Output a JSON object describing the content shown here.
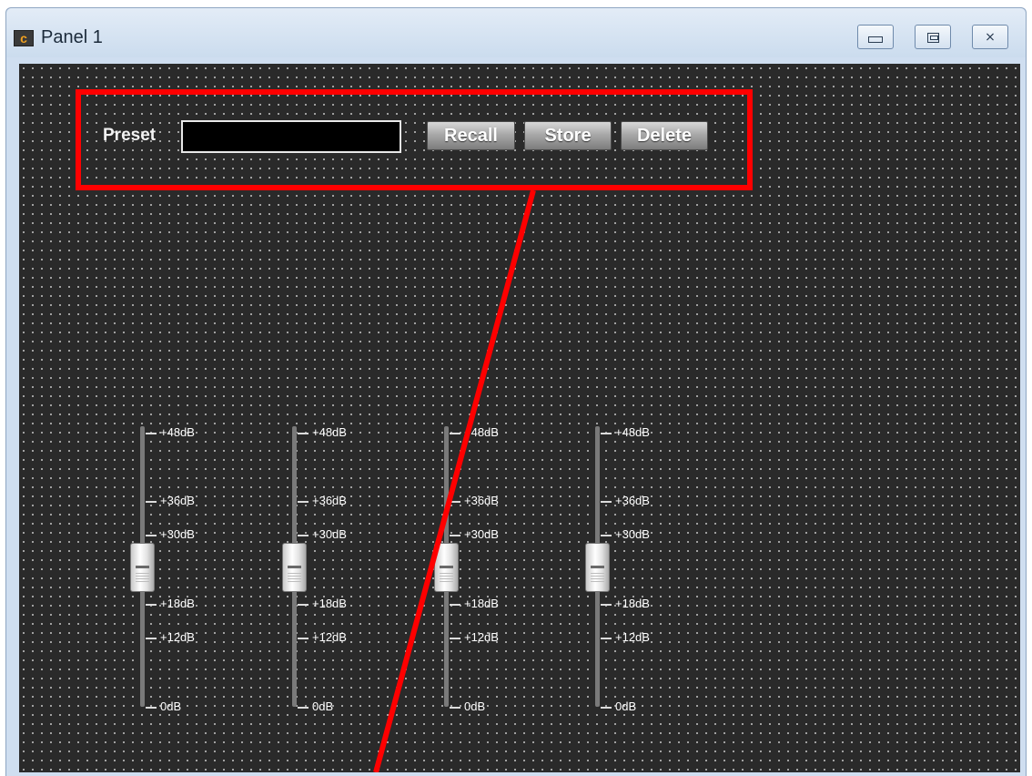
{
  "window": {
    "title": "Panel 1",
    "app_icon_letter": "c",
    "controls": [
      "minimize-icon",
      "maximize-icon",
      "close-icon"
    ]
  },
  "preset": {
    "label": "Preset",
    "input_value": "",
    "buttons": {
      "recall": "Recall",
      "store": "Store",
      "delete": "Delete"
    }
  },
  "faders": [
    {
      "ticks": [
        "+48dB",
        "+36dB",
        "+30dB",
        "+18dB",
        "+12dB",
        "0dB"
      ]
    },
    {
      "ticks": [
        "+48dB",
        "+36dB",
        "+30dB",
        "+18dB",
        "+12dB",
        "0dB"
      ]
    },
    {
      "ticks": [
        "+48dB",
        "+36dB",
        "+30dB",
        "+18dB",
        "+12dB",
        "0dB"
      ]
    },
    {
      "ticks": [
        "+48dB",
        "+36dB",
        "+30dB",
        "+18dB",
        "+12dB",
        "0dB"
      ]
    }
  ],
  "annotation": {
    "color": "#ff0000"
  }
}
